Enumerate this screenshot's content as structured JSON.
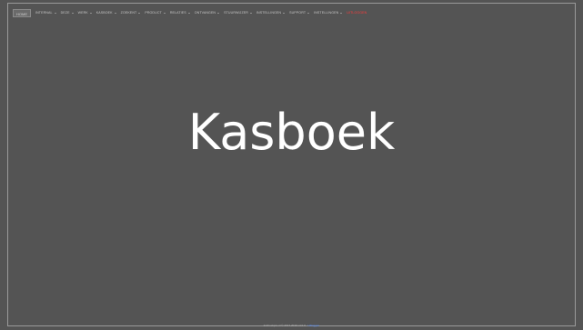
{
  "navbar": {
    "home_label": "HOME",
    "items": [
      {
        "label": "INTERNAL",
        "caret": true
      },
      {
        "label": "DEZE",
        "caret": true
      },
      {
        "label": "WERK",
        "caret": true
      },
      {
        "label": "KASBOEK",
        "caret": true
      },
      {
        "label": "ZOEKENT",
        "caret": true
      },
      {
        "label": "PRODUCT",
        "caret": true
      },
      {
        "label": "RELATIES",
        "caret": true
      },
      {
        "label": "ONTVANGEN",
        "caret": true
      },
      {
        "label": "STUURWIJZER",
        "caret": true
      },
      {
        "label": "INSTELLINGEN",
        "caret": true
      },
      {
        "label": "SUPPORT",
        "caret": true
      },
      {
        "label": "INSTELLINGEN",
        "caret": true
      }
    ],
    "logout_label": "UITLOGGEN"
  },
  "main": {
    "title": "Kasboek"
  },
  "footer": {
    "text": "kasboekpro.nl © 2017-2019 v4.0.3",
    "link_label": "Uitloggen"
  },
  "colors": {
    "background": "#545454",
    "frame_border": "#9a9a9a",
    "nav_text": "#c8c8c8",
    "logout": "#ff3b3b",
    "title": "#ffffff",
    "footer_link": "#4f8bff"
  }
}
